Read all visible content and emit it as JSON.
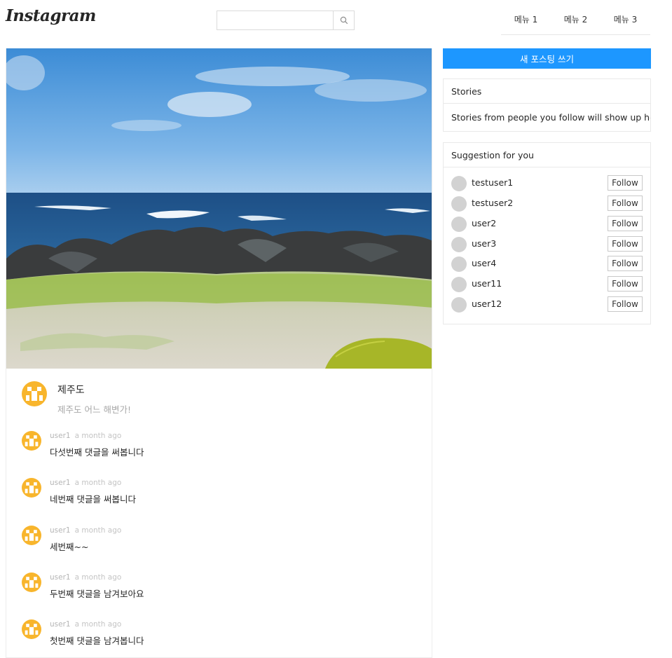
{
  "header": {
    "logo": "Instagram",
    "search": {
      "value": "",
      "placeholder": ""
    },
    "menus": [
      "메뉴 1",
      "메뉴 2",
      "메뉴 3"
    ]
  },
  "post": {
    "title": "제주도",
    "body": "제주도 어느 해변가!",
    "comments": [
      {
        "user": "user1",
        "time": "a month ago",
        "text": "다섯번째 댓글을 써봅니다"
      },
      {
        "user": "user1",
        "time": "a month ago",
        "text": "네번째 댓글을 써봅니다"
      },
      {
        "user": "user1",
        "time": "a month ago",
        "text": "세번째~~"
      },
      {
        "user": "user1",
        "time": "a month ago",
        "text": "두번째 댓글을 남겨보아요"
      },
      {
        "user": "user1",
        "time": "a month ago",
        "text": "첫번째 댓글을 남겨봅니다"
      }
    ]
  },
  "sidebar": {
    "new_post_label": "새 포스팅 쓰기",
    "stories": {
      "title": "Stories",
      "empty_text": "Stories from people you follow will show up here"
    },
    "suggestions": {
      "title": "Suggestion for you",
      "follow_label": "Follow",
      "users": [
        "testuser1",
        "testuser2",
        "user2",
        "user3",
        "user4",
        "user11",
        "user12"
      ]
    }
  },
  "colors": {
    "accent": "#1d97ff",
    "avatar_yellow": "#f8b52c"
  }
}
